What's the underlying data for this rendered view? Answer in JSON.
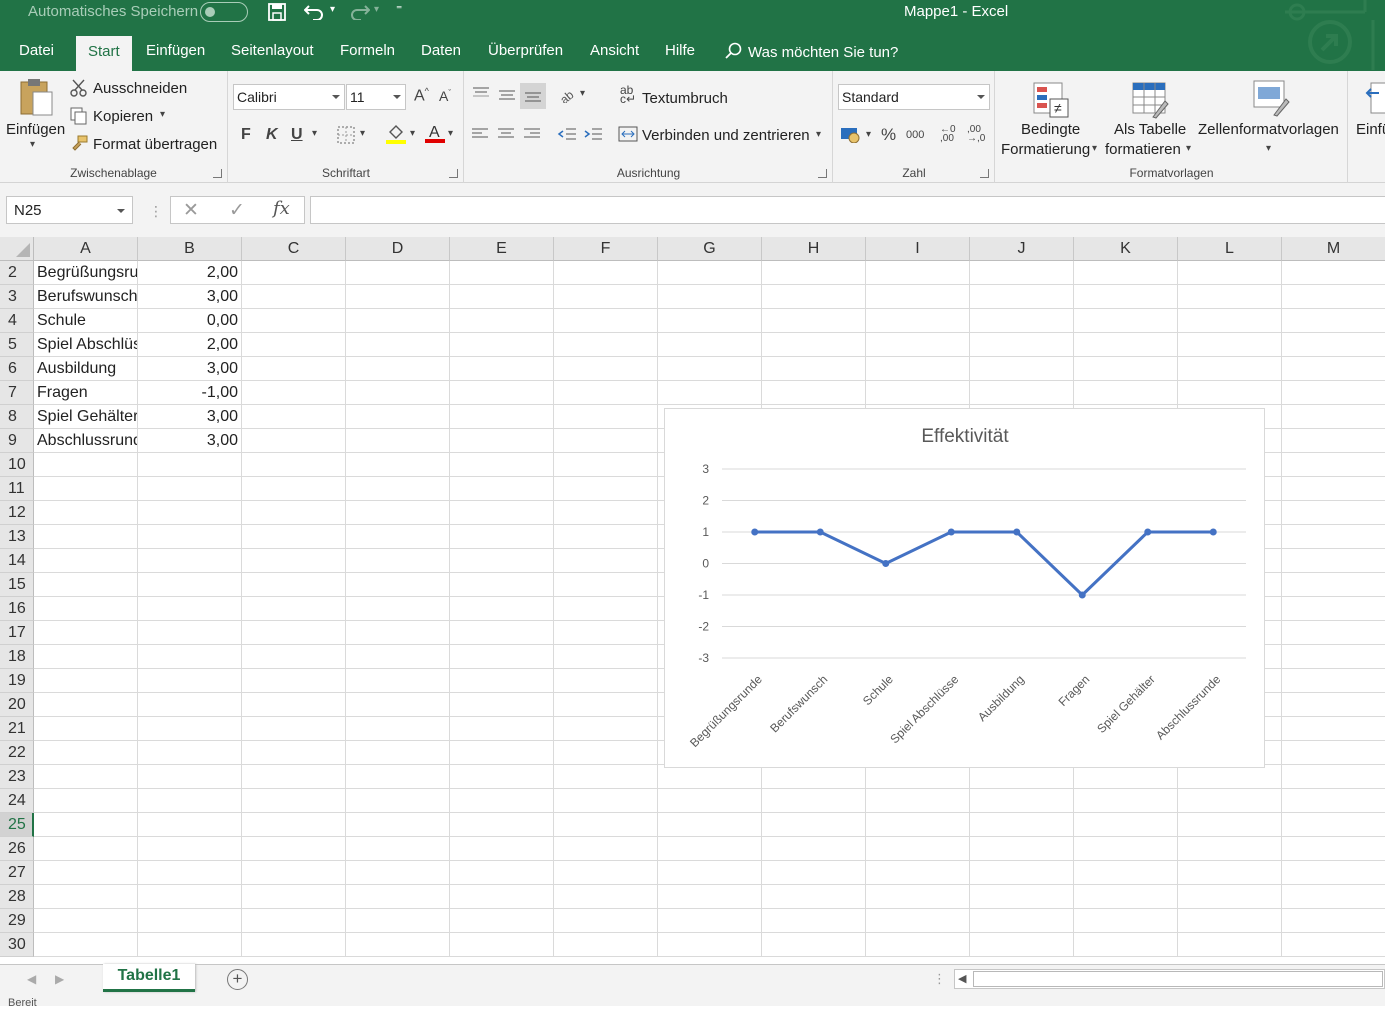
{
  "titlebar": {
    "autosave": "Automatisches Speichern",
    "window_title": "Mappe1  -  Excel"
  },
  "tabs": [
    "Datei",
    "Start",
    "Einfügen",
    "Seitenlayout",
    "Formeln",
    "Daten",
    "Überprüfen",
    "Ansicht",
    "Hilfe"
  ],
  "active_tab": "Start",
  "tellme": "Was möchten Sie tun?",
  "ribbon": {
    "clipboard": {
      "label": "Zwischenablage",
      "paste": "Einfügen",
      "cut": "Ausschneiden",
      "copy": "Kopieren",
      "format_painter": "Format übertragen"
    },
    "font": {
      "label": "Schriftart",
      "name": "Calibri",
      "size": "11",
      "bold": "F",
      "italic": "K",
      "underline": "U"
    },
    "alignment": {
      "label": "Ausrichtung",
      "wrap": "Textumbruch",
      "merge": "Verbinden und zentrieren"
    },
    "number": {
      "label": "Zahl",
      "format": "Standard",
      "percent": "%",
      "thousands": "000"
    },
    "styles": {
      "label": "Formatvorlagen",
      "conditional_1": "Bedingte",
      "conditional_2": "Formatierung",
      "as_table_1": "Als Tabelle",
      "as_table_2": "formatieren",
      "cell_styles": "Zellenformatvorlagen"
    },
    "cells": {
      "insert": "Einfü"
    }
  },
  "formula_bar": {
    "name_box": "N25",
    "fx": "fx",
    "content": ""
  },
  "columns": [
    "A",
    "B",
    "C",
    "D",
    "E",
    "F",
    "G",
    "H",
    "I",
    "J",
    "K",
    "L",
    "M"
  ],
  "rows": [
    "2",
    "3",
    "4",
    "5",
    "6",
    "7",
    "8",
    "9",
    "10",
    "11",
    "12",
    "13",
    "14",
    "15",
    "16",
    "17",
    "18",
    "19",
    "20",
    "21",
    "22",
    "23",
    "24",
    "25",
    "26",
    "27",
    "28",
    "29",
    "30"
  ],
  "selected_row": "25",
  "table": [
    {
      "a": "Begrüßungsrunde",
      "b": "2,00"
    },
    {
      "a": "Berufswunsch",
      "b": "3,00"
    },
    {
      "a": "Schule",
      "b": "0,00"
    },
    {
      "a": "Spiel Abschlüsse",
      "b": "2,00"
    },
    {
      "a": "Ausbildung",
      "b": "3,00"
    },
    {
      "a": "Fragen",
      "b": "-1,00"
    },
    {
      "a": "Spiel Gehälter",
      "b": "3,00"
    },
    {
      "a": "Abschlussrunde",
      "b": "3,00"
    }
  ],
  "chart_data": {
    "type": "line",
    "title": "Effektivität",
    "categories": [
      "Begrüßungsrunde",
      "Berufswunsch",
      "Schule",
      "Spiel Abschlüsse",
      "Ausbildung",
      "Fragen",
      "Spiel Gehälter",
      "Abschlussrunde"
    ],
    "values": [
      1,
      1,
      0,
      1,
      1,
      -1,
      1,
      1
    ],
    "ylim": [
      -3,
      3
    ],
    "yticks": [
      "3",
      "2",
      "1",
      "0",
      "-1",
      "-2",
      "-3"
    ],
    "grid": true,
    "color": "#4472c4"
  },
  "sheet_tabs": [
    "Tabelle1"
  ],
  "status": "Bereit",
  "colors": {
    "accent": "#217346",
    "series": "#4472c4"
  }
}
